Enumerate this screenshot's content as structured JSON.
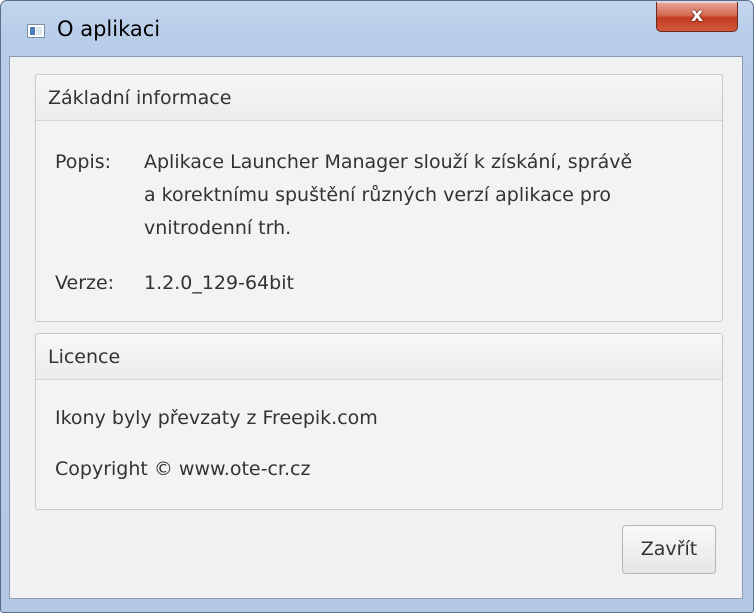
{
  "window": {
    "title": "O aplikaci",
    "close_glyph": "x"
  },
  "basic_info": {
    "header": "Základní informace",
    "description_label": "Popis:",
    "description_lines": [
      "Aplikace Launcher Manager slouží k získání, správě",
      "a korektnímu spuštění různých verzí aplikace pro",
      "vnitrodenní trh."
    ],
    "version_label": "Verze:",
    "version_value": "1.2.0_129-64bit"
  },
  "license": {
    "header": "Licence",
    "icons_credit": "Ikony byly převzaty z Freepik.com",
    "copyright": "Copyright © www.ote-cr.cz"
  },
  "footer": {
    "close_button_label": "Zavřít"
  }
}
